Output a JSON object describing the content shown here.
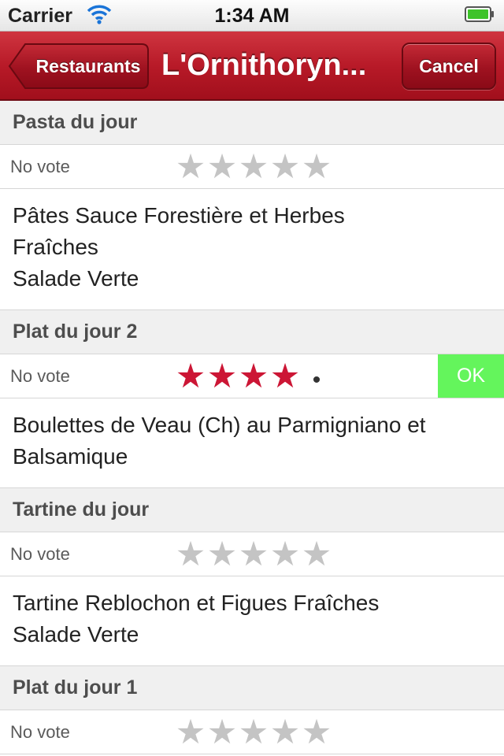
{
  "status_bar": {
    "carrier": "Carrier",
    "time": "1:34 AM",
    "icons": [
      "wifi-icon",
      "battery-icon"
    ]
  },
  "nav": {
    "back_label": "Restaurants",
    "title": "L'Ornithoryn...",
    "cancel_label": "Cancel"
  },
  "colors": {
    "nav_red": "#b81a28",
    "star_on": "#cc1635",
    "star_off": "#c4c4c4",
    "ok_green": "#64f55c"
  },
  "sections": [
    {
      "title": "Pasta du jour",
      "vote_label": "No vote",
      "rating": 0,
      "max_rating": 5,
      "description": [
        "Pâtes Sauce Forestière et Herbes",
        "Fraîches",
        "Salade Verte"
      ]
    },
    {
      "title": "Plat du jour 2",
      "vote_label": "No vote",
      "rating": 4,
      "max_rating": 5,
      "ok_label": "OK",
      "description": [
        "Boulettes de Veau (Ch) au Parmigniano et",
        "Balsamique"
      ]
    },
    {
      "title": "Tartine du jour",
      "vote_label": "No vote",
      "rating": 0,
      "max_rating": 5,
      "description": [
        "Tartine Reblochon et Figues Fraîches",
        "Salade Verte"
      ]
    },
    {
      "title": "Plat du jour 1",
      "vote_label": "No vote",
      "rating": 0,
      "max_rating": 5,
      "description": []
    }
  ]
}
